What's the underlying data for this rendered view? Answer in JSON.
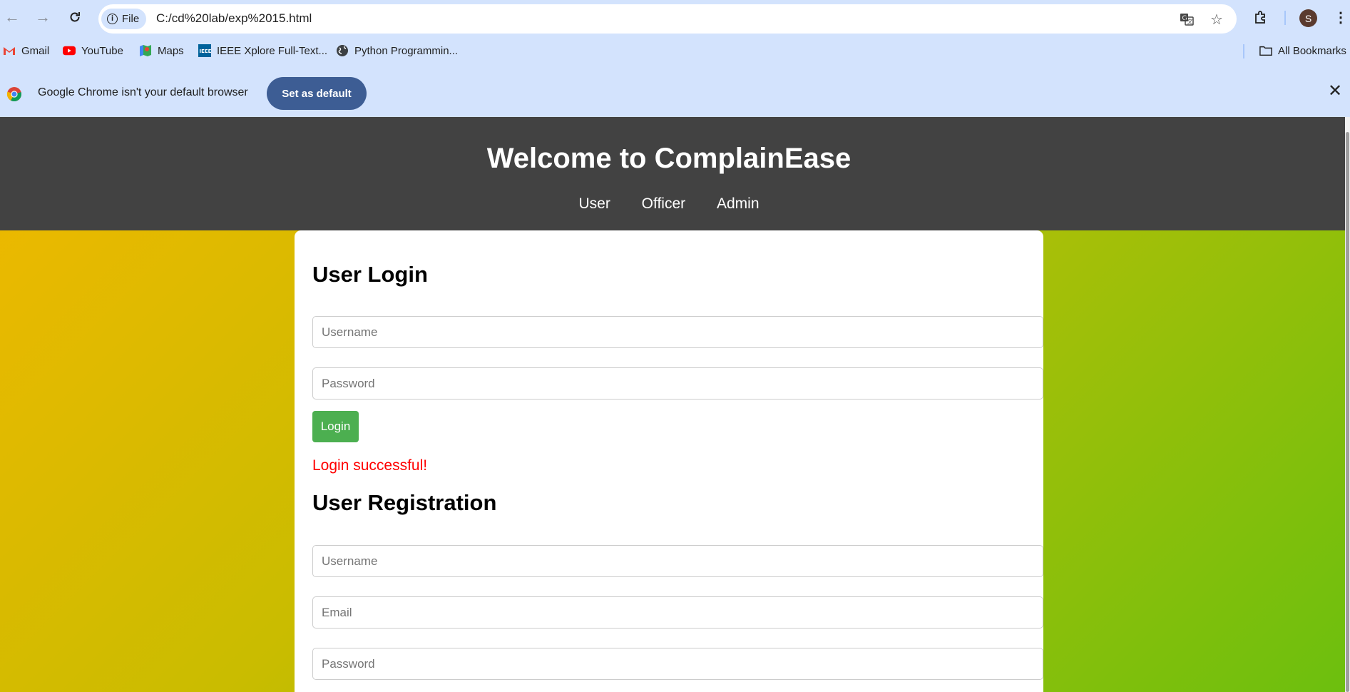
{
  "browser": {
    "nav": {
      "back_icon": "back-arrow-icon",
      "forward_icon": "forward-arrow-icon",
      "reload_icon": "reload-icon"
    },
    "address_bar": {
      "chip_label": "File",
      "url": "C:/cd%20lab/exp%2015.html"
    },
    "profile_initial": "S",
    "bookmarks": [
      {
        "label": "Gmail",
        "icon": "gmail-icon"
      },
      {
        "label": "YouTube",
        "icon": "youtube-icon"
      },
      {
        "label": "Maps",
        "icon": "maps-icon"
      },
      {
        "label": "IEEE Xplore Full-Text...",
        "icon": "ieee-icon"
      },
      {
        "label": "Python Programmin...",
        "icon": "globe-icon"
      }
    ],
    "all_bookmarks_label": "All Bookmarks",
    "infobar": {
      "text": "Google Chrome isn't your default browser",
      "button": "Set as default"
    }
  },
  "page": {
    "title": "Welcome to ComplainEase",
    "nav": [
      "User",
      "Officer",
      "Admin"
    ],
    "login": {
      "heading": "User Login",
      "username_placeholder": "Username",
      "password_placeholder": "Password",
      "button": "Login",
      "message": "Login successful!",
      "message_color": "#ff0000"
    },
    "registration": {
      "heading": "User Registration",
      "username_placeholder": "Username",
      "email_placeholder": "Email",
      "password_placeholder": "Password"
    }
  },
  "colors": {
    "header_bg": "#424242",
    "login_button": "#4caf50",
    "chrome_bg": "#d3e3fd",
    "set_default_button": "#3d5d94"
  }
}
